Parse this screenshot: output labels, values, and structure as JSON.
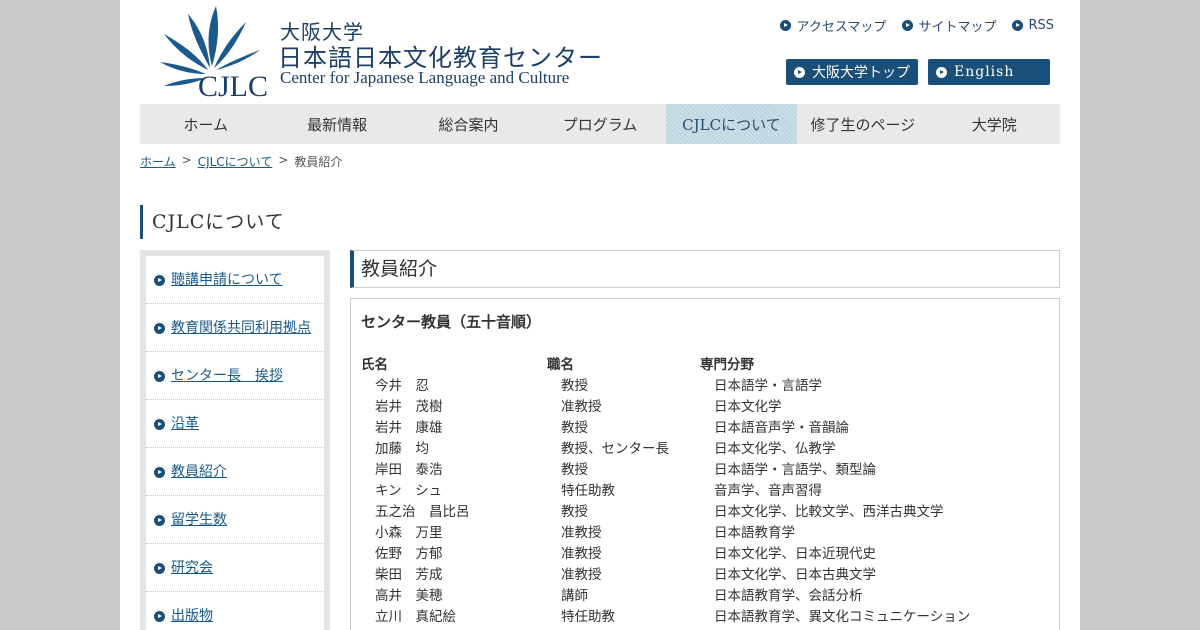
{
  "header": {
    "logo_ja_line1": "大阪大学",
    "logo_ja_line2": "日本語日本文化教育センター",
    "logo_en": "Center for Japanese Language and Culture",
    "logo_mark_text": "CJLC",
    "util_links": [
      "アクセスマップ",
      "サイトマップ",
      "RSS"
    ],
    "btn_osaka": "大阪大学トップ",
    "btn_english": "English"
  },
  "gnav": [
    "ホーム",
    "最新情報",
    "総合案内",
    "プログラム",
    "CJLCについて",
    "修了生のページ",
    "大学院"
  ],
  "breadcrumb": {
    "home": "ホーム",
    "sep": ">",
    "section": "CJLCについて",
    "current": "教員紹介"
  },
  "section_title": "CJLCについて",
  "sidebar": [
    "聴講申請について",
    "教育関係共同利用拠点",
    "センター長　挨拶",
    "沿革",
    "教員紹介",
    "留学生数",
    "研究会",
    "出版物"
  ],
  "main": {
    "title": "教員紹介",
    "subtitle": "センター教員（五十音順）",
    "columns": [
      "氏名",
      "職名",
      "専門分野"
    ],
    "rows": [
      [
        "今井　忍",
        "教授",
        "日本語学・言語学"
      ],
      [
        "岩井　茂樹",
        "准教授",
        "日本文化学"
      ],
      [
        "岩井　康雄",
        "教授",
        "日本語音声学・音韻論"
      ],
      [
        "加藤　均",
        "教授、センター長",
        "日本文化学、仏教学"
      ],
      [
        "岸田　泰浩",
        "教授",
        "日本語学・言語学、類型論"
      ],
      [
        "キン　シュ",
        "特任助教",
        "音声学、音声習得"
      ],
      [
        "五之治　昌比呂",
        "教授",
        "日本文化学、比較文学、西洋古典文学"
      ],
      [
        "小森　万里",
        "准教授",
        "日本語教育学"
      ],
      [
        "佐野　方郁",
        "准教授",
        "日本文化学、日本近現代史"
      ],
      [
        "柴田　芳成",
        "准教授",
        "日本文化学、日本古典文学"
      ],
      [
        "高井　美穂",
        "講師",
        "日本語教育学、会話分析"
      ],
      [
        "立川　真紀絵",
        "特任助教",
        "日本語教育学、異文化コミュニケーション"
      ]
    ]
  },
  "colors": {
    "accent": "#1a4f7a",
    "nav_bg": "#e9e9e9",
    "nav_active": "#bcd5e0"
  }
}
